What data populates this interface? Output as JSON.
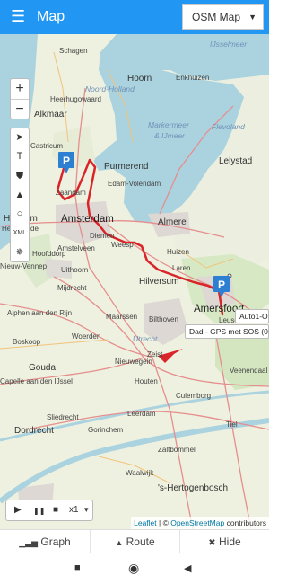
{
  "header": {
    "title": "Map",
    "layer_select": {
      "selected": "OSM Map"
    }
  },
  "map": {
    "labels": {
      "schagen": "Schagen",
      "hoorn": "Hoorn",
      "enkhuizen": "Enkhuizen",
      "noord_holland": "Noord-Holland",
      "heerhugowaard": "Heerhugowaard",
      "alkmaar": "Alkmaar",
      "castricum": "Castricum",
      "purmerend": "Purmerend",
      "edam": "Edam-Volendam",
      "zaandam": "Zaandam",
      "amsterdam": "Amsterdam",
      "almere": "Almere",
      "lelystad": "Lelystad",
      "flevoland": "Flevoland",
      "markermeer": "Markermeer",
      "ijmeer": "& IJmeer",
      "ijsselmeer": "IJsselmeer",
      "haarlem": "Haarlem",
      "heemstede": "Heemstede",
      "amstelveen": "Amstelveen",
      "hoofddorp": "Hoofddorp",
      "weesp": "Weesp",
      "huizen": "Huizen",
      "diemen": "Diemen",
      "hilversum": "Hilversum",
      "laren": "Laren",
      "nieuw_vennep": "Nieuw-Vennep",
      "uithoorn": "Uithoorn",
      "mijdrecht": "Mijdrecht",
      "maarssen": "Maarssen",
      "bilthoven": "Bilthoven",
      "utrecht": "Utrecht",
      "amersfoort": "Amersfoort",
      "leusden": "Leusden",
      "alphen": "Alphen aan den Rijn",
      "woerden": "Woerden",
      "nieuwegein": "Nieuwegein",
      "zeist": "Zeist",
      "boskoop": "Boskoop",
      "gouda": "Gouda",
      "capelle": "Capelle aan den IJssel",
      "houten": "Houten",
      "veenendaal": "Veenendaal",
      "culemborg": "Culemborg",
      "leerdam": "Leerdam",
      "tiel": "Tiel",
      "sliedrecht": "Sliedrecht",
      "gorinchem": "Gorinchem",
      "dordrecht": "Dordrecht",
      "zaltbommel": "Zaltbommel",
      "waalwijk": "Waalwijk",
      "den_bosch": "'s-Hertogenbosch"
    },
    "markers": [
      {
        "id": "marker-start",
        "letter": "P"
      },
      {
        "id": "marker-end",
        "letter": "P"
      }
    ],
    "tooltips": {
      "end": "Auto1-O",
      "arrow": "Dad - GPS met SOS (0 k"
    },
    "controls": {
      "zoom_in": "+",
      "zoom_out": "−",
      "tools": {
        "locate": "➤",
        "text": "T",
        "shield": "⛊",
        "road": "▲",
        "circle": "○",
        "xml": "XML",
        "sun": "✵"
      }
    },
    "player": {
      "play": "▶",
      "pause": "❚❚",
      "stop": "■",
      "speed": "x1",
      "speed_caret": "▾"
    },
    "attribution": {
      "leaflet": "Leaflet",
      "sep": " | © ",
      "osm": "OpenStreetMap",
      "contributors": " contributors"
    },
    "colors": {
      "route": "#d9252a",
      "marker": "#2c7fd1",
      "water": "#aad3df"
    }
  },
  "bottom_bar": {
    "graph": {
      "icon": "▁▃▅",
      "label": "Graph"
    },
    "route": {
      "icon": "▲",
      "label": "Route"
    },
    "hide": {
      "icon": "✖",
      "label": "Hide"
    }
  },
  "system_nav": {
    "square": "■",
    "circle": "◉",
    "back": "◀"
  }
}
